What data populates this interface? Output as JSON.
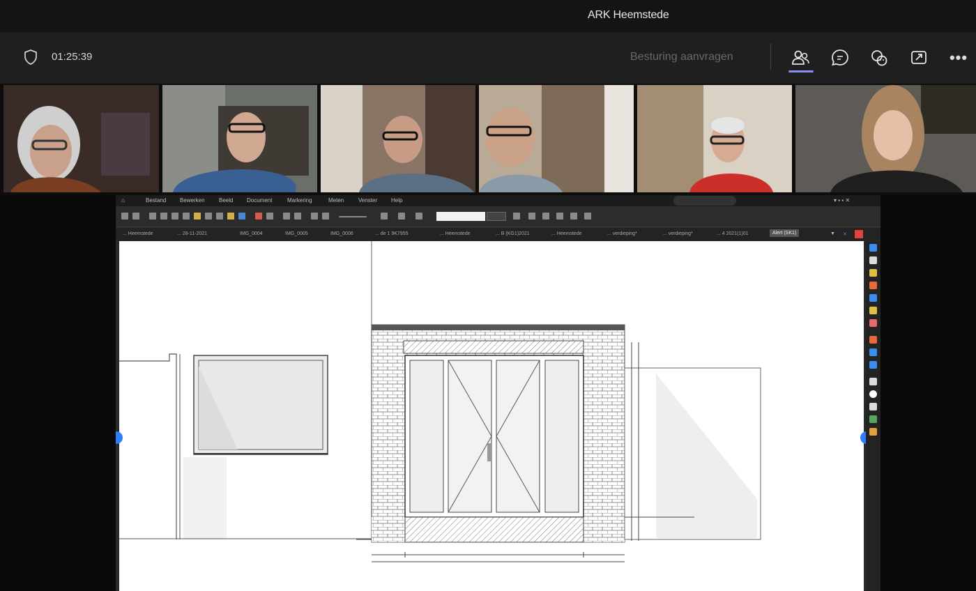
{
  "window": {
    "title": "ARK Heemstede"
  },
  "call": {
    "timer": "01:25:39",
    "request_control_label": "Besturing aanvragen",
    "icons": [
      "shield-icon",
      "people-icon",
      "chat-icon",
      "reactions-icon",
      "share-tray-icon",
      "more-icon"
    ],
    "accent_color": "#8b8cf0"
  },
  "participants": [
    {
      "name": "",
      "active": true
    },
    {
      "name": "",
      "active": true
    },
    {
      "name": "",
      "active": false
    },
    {
      "name": "",
      "active": false
    },
    {
      "name": "",
      "active": false
    },
    {
      "name": "",
      "active": false
    }
  ],
  "shared_app": {
    "menus": [
      "Bestand",
      "Bewerken",
      "Beeld",
      "Document",
      "Markering",
      "Meten",
      "Venster",
      "Help"
    ],
    "tabs": [
      "... Heemstede",
      "... 28-11-2021",
      "IMG_0004",
      "IMG_0005",
      "IMG_0006",
      "... de 1 9K7955",
      "... Heemstede",
      "... B (KG1)2021",
      "... Heemstede",
      "... verdieping*",
      "... verdieping*",
      "... 4 2021(1)01",
      "Alert (SK1)"
    ]
  }
}
